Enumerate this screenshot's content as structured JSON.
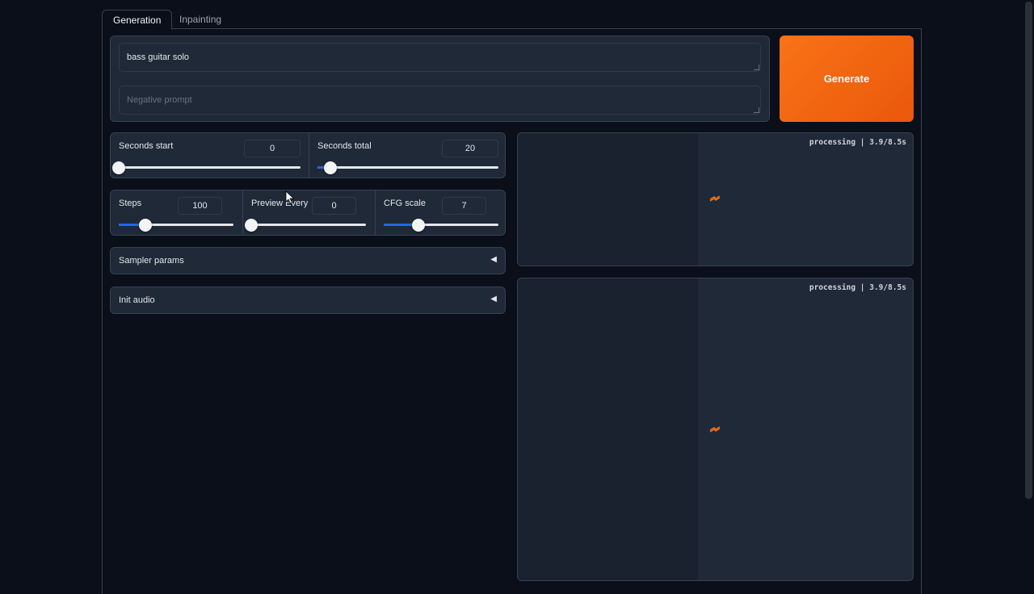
{
  "tabs": [
    {
      "label": "Generation",
      "active": true
    },
    {
      "label": "Inpainting",
      "active": false
    }
  ],
  "prompt": {
    "value": "bass guitar solo",
    "negative_placeholder": "Negative prompt",
    "negative_value": ""
  },
  "generate_button": {
    "label": "Generate",
    "color": "#ea580c"
  },
  "sliders": {
    "seconds_start": {
      "label": "Seconds start",
      "value": "0",
      "fraction": 0.0
    },
    "seconds_total": {
      "label": "Seconds total",
      "value": "20",
      "fraction": 0.07
    },
    "steps": {
      "label": "Steps",
      "value": "100",
      "fraction": 0.23
    },
    "preview_every": {
      "label": "Preview Every",
      "value": "0",
      "fraction": 0.0
    },
    "cfg_scale": {
      "label": "CFG scale",
      "value": "7",
      "fraction": 0.3
    }
  },
  "accordions": [
    {
      "label": "Sampler params",
      "arrow": "◀"
    },
    {
      "label": "Init audio",
      "arrow": "◀"
    }
  ],
  "outputs": [
    {
      "status": "processing | 3.9/8.5s"
    },
    {
      "status": "processing | 3.9/8.5s"
    }
  ],
  "colors": {
    "accent": "#2563eb",
    "brand": "#f97316",
    "background": "#0b0f19",
    "panel": "#1f2937"
  }
}
